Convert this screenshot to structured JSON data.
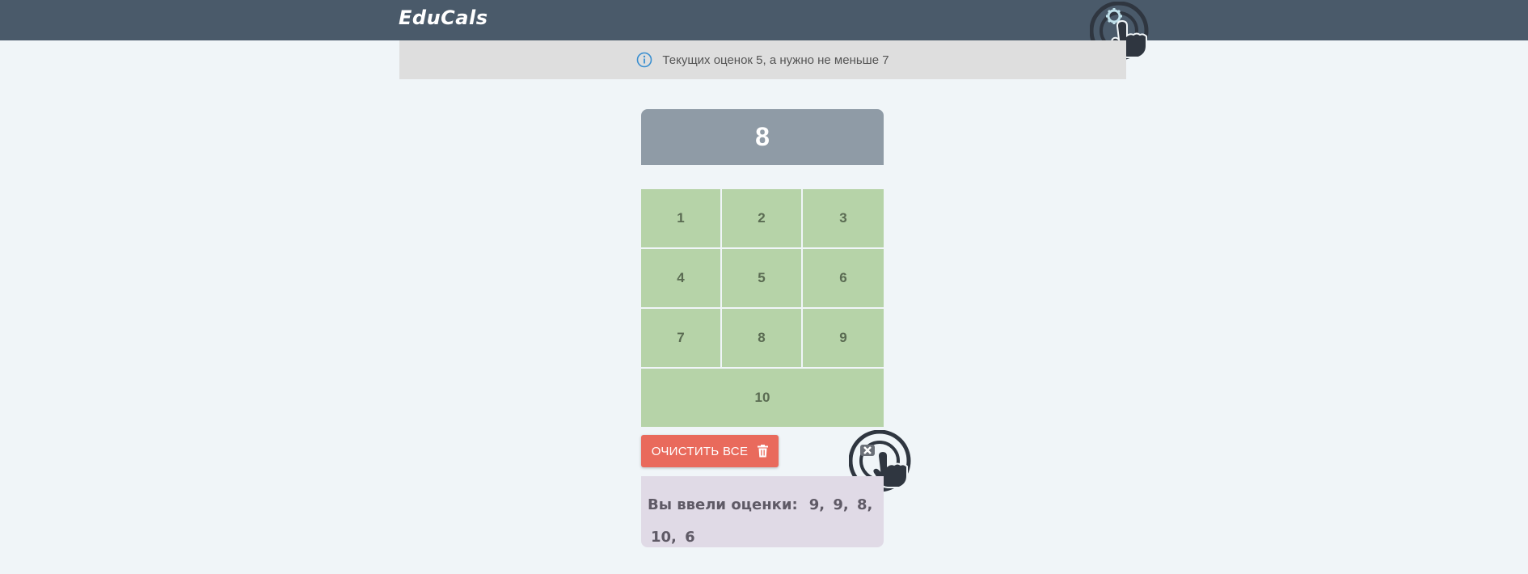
{
  "header": {
    "logo": "EduCals",
    "bg_color": "#4a5a6a",
    "settings_icon": "gear-icon"
  },
  "notice": {
    "text": "Текущих оценок 5, а нужно не меньше 7",
    "icon": "info-icon"
  },
  "display": {
    "value": "8"
  },
  "keypad": {
    "keys": [
      "1",
      "2",
      "3",
      "4",
      "5",
      "6",
      "7",
      "8",
      "9",
      "10"
    ],
    "color": "#b6d3a8"
  },
  "clear_button": {
    "label": "ОЧИСТИТЬ ВСЕ",
    "icon": "trash-icon",
    "color": "#e96a5c"
  },
  "grades": {
    "label": "Вы ввели оценки:",
    "values": [
      "9,",
      "9,",
      "8,",
      "10,",
      "6"
    ]
  }
}
